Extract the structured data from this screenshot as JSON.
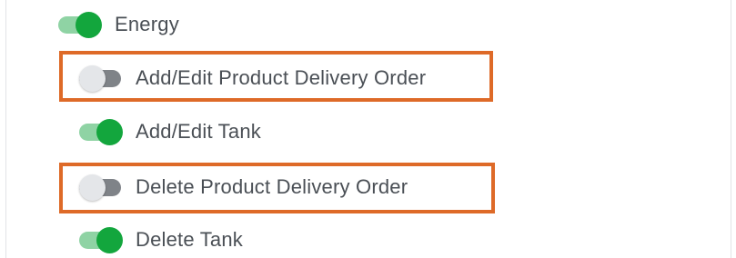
{
  "colors": {
    "toggle_on_knob": "#13a63d",
    "toggle_on_track": "#8fd3a4",
    "toggle_off_knob": "#e4e6e9",
    "toggle_off_track": "#7f8388",
    "highlight_border": "#de6a28",
    "label_text": "#4a4f55"
  },
  "permissions": [
    {
      "label": "Energy",
      "enabled": true,
      "highlighted": false
    },
    {
      "label": "Add/Edit Product Delivery Order",
      "enabled": false,
      "highlighted": true
    },
    {
      "label": "Add/Edit Tank",
      "enabled": true,
      "highlighted": false
    },
    {
      "label": "Delete Product Delivery Order",
      "enabled": false,
      "highlighted": true
    },
    {
      "label": "Delete Tank",
      "enabled": true,
      "highlighted": false
    }
  ]
}
